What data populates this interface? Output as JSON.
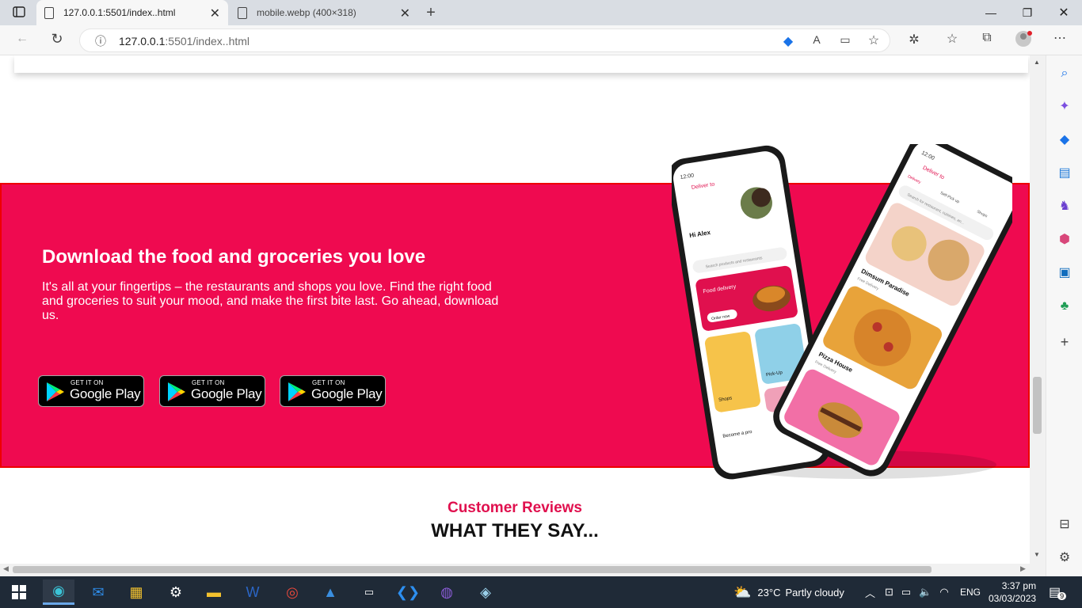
{
  "browser": {
    "tabs": [
      {
        "title": "127.0.0.1:5501/index..html"
      },
      {
        "title": "mobile.webp (400×318)"
      }
    ],
    "address": {
      "host": "127.0.0.1",
      "rest": ":5501/index..html"
    }
  },
  "banner": {
    "heading": "Download the food and groceries you love",
    "body": "It's all at your fingertips – the restaurants and shops you love. Find the right food and groceries to suit your mood, and make the first bite last. Go ahead, download us.",
    "store_buttons": [
      {
        "small": "GET IT ON",
        "big": "Google Play"
      },
      {
        "small": "GET IT ON",
        "big": "Google Play"
      },
      {
        "small": "GET IT ON",
        "big": "Google Play"
      }
    ],
    "bg_color": "#ef0a50"
  },
  "phone_screens": {
    "left": {
      "time": "12:00",
      "deliver": "Deliver to",
      "greeting": "Hi Alex",
      "search": "Search products and restaurants",
      "card1": "Food delivery",
      "card1_btn": "Order now",
      "card2": "Shops",
      "card3": "Pick-Up",
      "footer": "Become a pro"
    },
    "right": {
      "time": "12:00",
      "deliver": "Deliver to",
      "tab1": "Delivery",
      "tab2": "Self-Pick up",
      "tab3": "Shops",
      "search": "Search for restaurant, cuisines, an...",
      "r1": "Dimsum Paradise",
      "r1_sub": "Free Delivery",
      "r2": "Pizza House",
      "r2_sub": "Free Delivery"
    }
  },
  "reviews": {
    "subtitle": "Customer Reviews",
    "title": "WHAT THEY SAY..."
  },
  "taskbar": {
    "weather": "23°C",
    "weather_desc": "Partly cloudy",
    "lang": "ENG",
    "time": "3:37 pm",
    "date": "03/03/2023",
    "notif": "9"
  }
}
